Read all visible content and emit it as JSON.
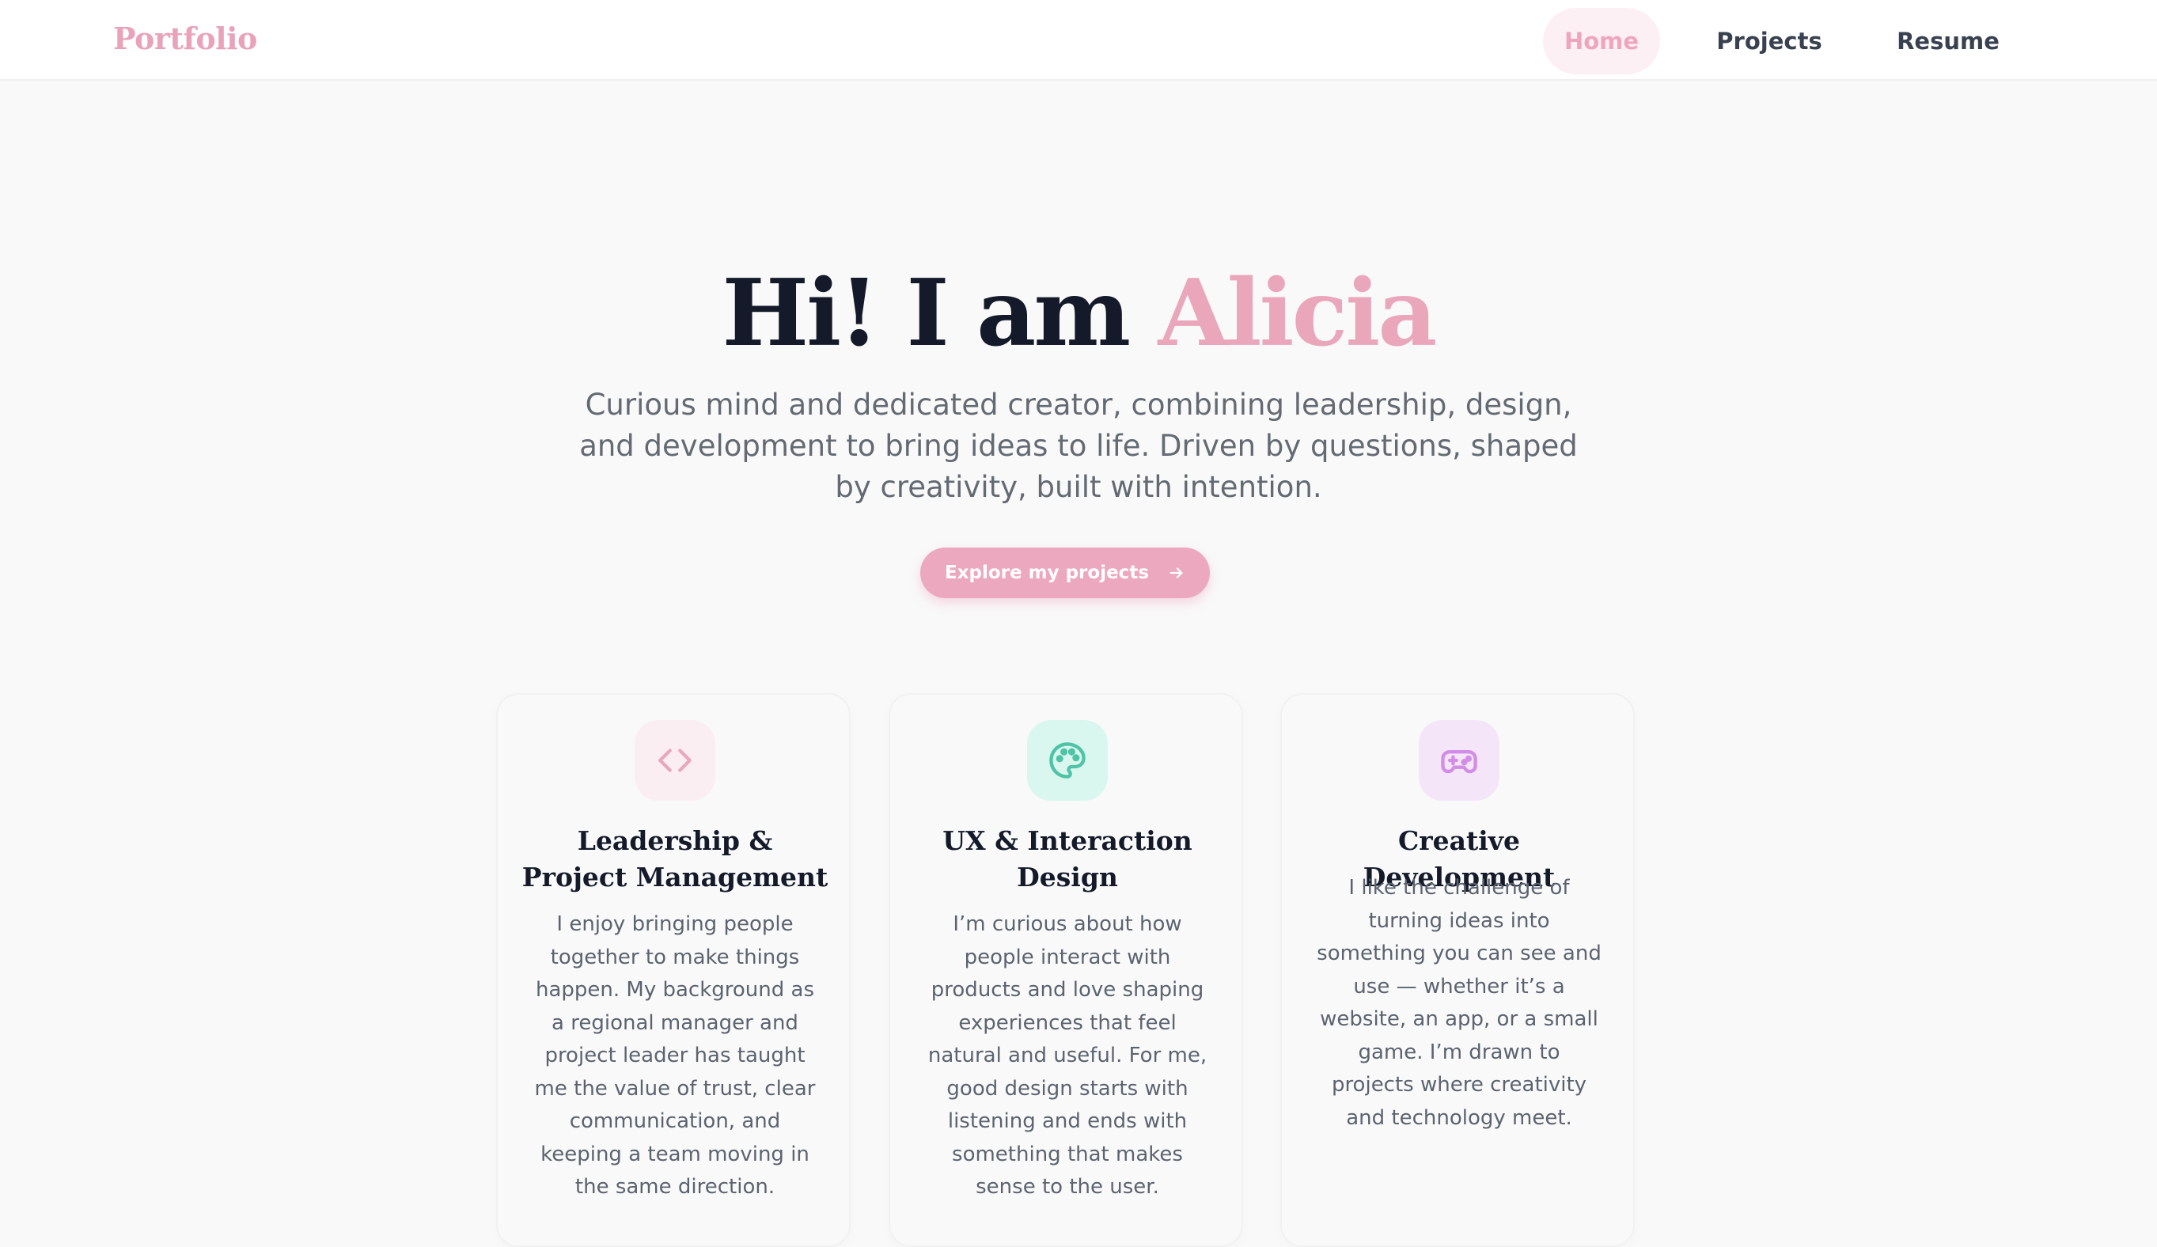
{
  "nav": {
    "brand": "Portfolio",
    "items": [
      {
        "label": "Home",
        "active": true
      },
      {
        "label": "Projects",
        "active": false
      },
      {
        "label": "Resume",
        "active": false
      }
    ]
  },
  "hero": {
    "title_prefix": "Hi! I am ",
    "title_name": "Alicia",
    "subtitle": "Curious mind and dedicated creator, combining leadership, design, and development to bring ideas to life. Driven by questions, shaped by creativity, built with intention.",
    "cta_label": "Explore my projects",
    "cta_icon": "arrow-right-icon"
  },
  "cards": [
    {
      "icon": "code-icon",
      "title": "Leadership & Project Management",
      "text": "I enjoy bringing people together to make things happen. My background as a regional manager and project leader has taught me the value of trust, clear communication, and keeping a team moving in the same direction."
    },
    {
      "icon": "palette-icon",
      "title": "UX & Interaction Design",
      "text": "I’m curious about how people interact with products and love shaping experiences that feel natural and useful. For me, good design starts with listening and ends with something that makes sense to the user."
    },
    {
      "icon": "gamepad-icon",
      "title": "Creative Development",
      "text": "I like the challenge of turning ideas into something you can see and use — whether it’s a website, an app, or a small game. I’m drawn to projects where creativity and technology meet."
    }
  ],
  "colors": {
    "accent_pink": "#eaa7bc",
    "nav_active_bg": "#fdf0f4",
    "heading_dark": "#141a2a",
    "body_text": "#5c6370",
    "page_bg": "#f9f9f9",
    "icon_teal": "#4fc3a6",
    "icon_purple": "#d28ee6"
  }
}
